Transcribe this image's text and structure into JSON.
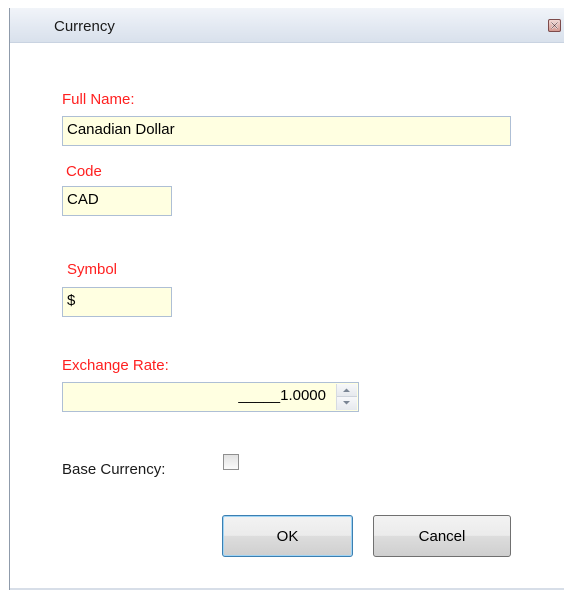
{
  "window": {
    "title": "Currency"
  },
  "form": {
    "full_name_label": "Full Name:",
    "full_name_value": "Canadian Dollar",
    "code_label": "Code",
    "code_value": "CAD",
    "symbol_label": "Symbol",
    "symbol_value": "$",
    "exchange_rate_label": "Exchange Rate:",
    "exchange_rate_value": "_____1.0000",
    "base_currency_label": "Base Currency:",
    "base_currency_checked": false
  },
  "buttons": {
    "ok_label": "OK",
    "cancel_label": "Cancel"
  },
  "colors": {
    "required_label": "#ff2020",
    "input_background": "#ffffe1"
  },
  "icons": {
    "close": "close-icon",
    "spin_up": "chevron-up-icon",
    "spin_down": "chevron-down-icon"
  }
}
